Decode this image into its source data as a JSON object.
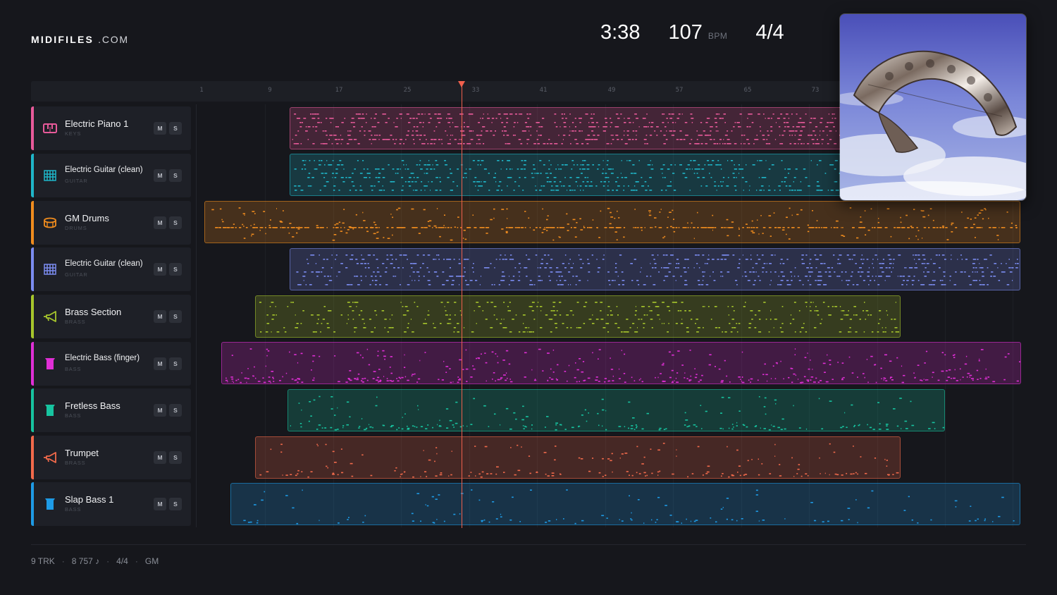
{
  "brand": {
    "name": "MIDIFILES",
    "suffix": ".COM"
  },
  "header": {
    "duration": "3:38",
    "bpm": "107",
    "bpm_unit": "BPM",
    "time_signature": "4/4"
  },
  "ruler": {
    "ticks": [
      "1",
      "9",
      "17",
      "25",
      "33",
      "41",
      "49",
      "57",
      "65",
      "73"
    ]
  },
  "tracks": [
    {
      "name": "Electric Piano 1",
      "category": "KEYS",
      "icon": "piano-icon",
      "color": "#e85a9a",
      "mute": "M",
      "solo": "S"
    },
    {
      "name": "Electric Guitar (clean)",
      "category": "GUITAR",
      "icon": "guitar-icon",
      "color": "#1fb6c9",
      "mute": "M",
      "solo": "S"
    },
    {
      "name": "GM Drums",
      "category": "DRUMS",
      "icon": "drum-icon",
      "color": "#f08c1e",
      "mute": "M",
      "solo": "S"
    },
    {
      "name": "Electric Guitar (clean)",
      "category": "GUITAR",
      "icon": "guitar-icon",
      "color": "#7b8cf0",
      "mute": "M",
      "solo": "S"
    },
    {
      "name": "Brass Section",
      "category": "BRASS",
      "icon": "horn-icon",
      "color": "#a7c62c",
      "mute": "M",
      "solo": "S"
    },
    {
      "name": "Electric Bass (finger)",
      "category": "BASS",
      "icon": "bass-icon",
      "color": "#e02fd6",
      "mute": "M",
      "solo": "S"
    },
    {
      "name": "Fretless Bass",
      "category": "BASS",
      "icon": "bass-icon",
      "color": "#17c4a0",
      "mute": "M",
      "solo": "S"
    },
    {
      "name": "Trumpet",
      "category": "BRASS",
      "icon": "horn-icon",
      "color": "#f26a4b",
      "mute": "M",
      "solo": "S"
    },
    {
      "name": "Slap Bass 1",
      "category": "BASS",
      "icon": "bass-icon",
      "color": "#1e9be6",
      "mute": "M",
      "solo": "S"
    }
  ],
  "footer": {
    "tracks": "9 TRK",
    "notes": "8 757 ♪",
    "time_signature": "4/4",
    "standard": "GM"
  }
}
